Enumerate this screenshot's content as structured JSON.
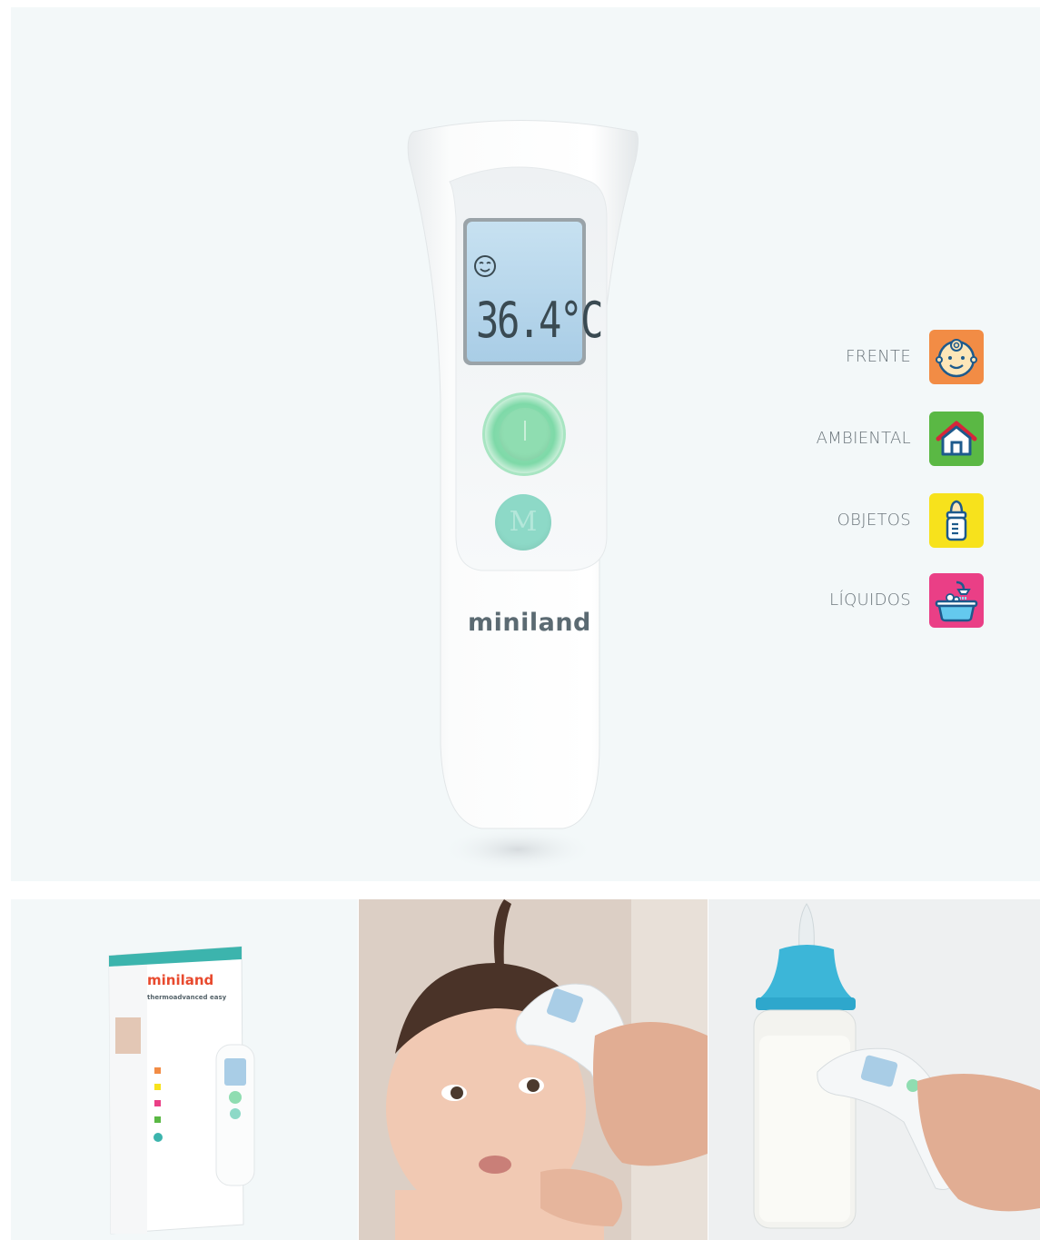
{
  "device": {
    "display_temperature": "36.4°C",
    "brand": "miniland",
    "lcd_icon": "smiley-face-icon",
    "power_button_icon": "power-icon",
    "mode_button_label": "M"
  },
  "modes": [
    {
      "label": "FRENTE",
      "icon": "baby-face-icon",
      "color": "#f28c45"
    },
    {
      "label": "AMBIENTAL",
      "icon": "house-icon",
      "color": "#5ab844"
    },
    {
      "label": "OBJETOS",
      "icon": "baby-bottle-icon",
      "color": "#f7e21c"
    },
    {
      "label": "LÍQUIDOS",
      "icon": "bathtub-icon",
      "color": "#ea3f86"
    }
  ],
  "gallery": {
    "box": {
      "brand": "miniland",
      "product": "thermoadvanced easy"
    },
    "photo_forehead": "child-forehead-measurement-photo",
    "photo_bottle": "baby-bottle-measurement-photo"
  },
  "colors": {
    "background": "#f3f8f9",
    "button_green": "#8fddb1",
    "button_teal": "#8dd9c7",
    "lcd_blue": "#b9d9ee"
  }
}
